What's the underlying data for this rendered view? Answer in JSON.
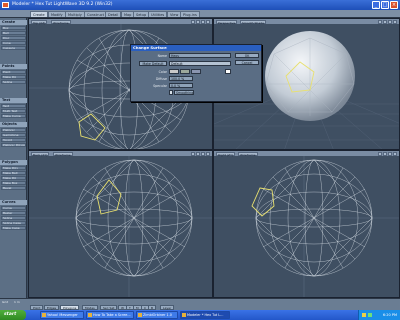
{
  "window": {
    "title": "Modeler * Hex Tut LightWave 3D 9.2 (Win32)",
    "controls": [
      "_",
      "□",
      "×"
    ]
  },
  "tabs": [
    "Create",
    "Modify",
    "Multiply",
    "Construct",
    "Detail",
    "Map",
    "Setup",
    "Utilities",
    "View",
    "Plug-ins"
  ],
  "toolbar_groups": [
    {
      "label": "Create",
      "items": [
        "Box",
        "Ball",
        "Disc",
        "Cone",
        "Capsule"
      ]
    },
    {
      "label": "Points",
      "items": [
        "Point",
        "Make Pol",
        "Spline"
      ]
    },
    {
      "label": "Text",
      "items": [
        "Text",
        "Multi Text",
        "Make Curve"
      ]
    },
    {
      "label": "Objects",
      "items": [
        "Platonic",
        "Gemstone",
        "Toroid",
        "Platonic Polygon"
      ]
    },
    {
      "label": "Polygon",
      "items": [
        "Make Poly",
        "Make Ball",
        "Make Pol",
        "Make Box",
        "Bevel"
      ]
    },
    {
      "label": "Curves",
      "items": [
        "Curve",
        "Bezier",
        "Spline",
        "Spline Cage",
        "Make Cage"
      ]
    }
  ],
  "viewports": [
    {
      "label": "Top (XZ)",
      "mode": "Wireframe"
    },
    {
      "label": "Perspective",
      "mode": "Smooth Shade"
    },
    {
      "label": "Back (XY)",
      "mode": "Wireframe"
    },
    {
      "label": "Right (ZY)",
      "mode": "Wireframe"
    }
  ],
  "dialog": {
    "title": "Change Surface",
    "name_label": "Name",
    "name_value": "Hexs",
    "ok_label": "OK",
    "cancel_label": "Cancel",
    "make_default_label": "Make Default",
    "default_label": "Default",
    "color_label": "Color",
    "diffuse_label": "Diffuse",
    "diffuse_value": "100.0 %",
    "specular_label": "Specular",
    "specular_value": "0.0 %",
    "smoothing_label": "Smoothing"
  },
  "status": {
    "grid": "Grid",
    "grid_value": "1 m",
    "buttons": [
      "Point",
      "Edges",
      "Polygons",
      "Modes",
      "Sel: Set",
      "W",
      "T",
      "M",
      "C",
      "B",
      "Layer"
    ]
  },
  "taskbar": {
    "start": "start",
    "items": [
      "Yahoo! Messenger",
      "How To Take a Scree...",
      "ZimbiOrbiner 1.0",
      "Modeler * Hex Tut L..."
    ],
    "clock": "6:20 PM"
  }
}
